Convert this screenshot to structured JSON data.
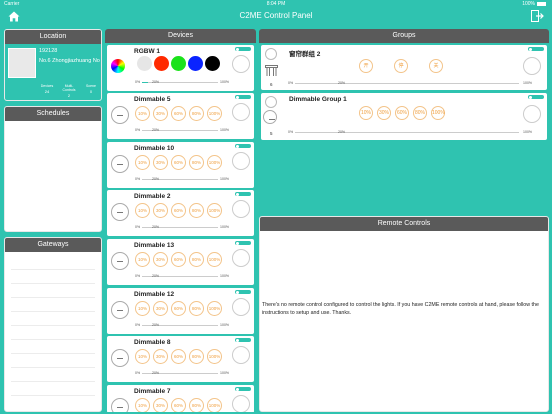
{
  "status": {
    "carrier": "Carrier",
    "time": "8:04 PM",
    "battery": "100%"
  },
  "nav": {
    "title": "C2ME Control Panel"
  },
  "location": {
    "header": "Location",
    "code": "192128",
    "address": "No.6 Zhongjiazhuang No",
    "stats": [
      {
        "label": "Devices",
        "value": "24"
      },
      {
        "label": "Multi-Controls",
        "value": "2"
      },
      {
        "label": "Scene",
        "value": "0"
      }
    ]
  },
  "schedules": {
    "header": "Schedules"
  },
  "gateways": {
    "header": "Gateways"
  },
  "devices": {
    "header": "Devices",
    "rgbw": {
      "name": "RGBW 1",
      "colors": [
        "#e6e6e6",
        "#ff2a00",
        "#1be21b",
        "#0a23ff",
        "#000000"
      ],
      "slider": {
        "lo": "0%",
        "mid": "20%",
        "hi": "100%",
        "value": 0.08
      }
    },
    "dimmables": [
      {
        "name": "Dimmable 5",
        "levels": [
          "10%",
          "30%",
          "60%",
          "80%",
          "100%"
        ],
        "slider": {
          "lo": "0%",
          "mid": "20%",
          "hi": "100%",
          "value": 0.0
        }
      },
      {
        "name": "Dimmable 10",
        "levels": [
          "10%",
          "30%",
          "60%",
          "80%",
          "100%"
        ],
        "slider": {
          "lo": "0%",
          "mid": "20%",
          "hi": "100%",
          "value": 0.0
        }
      },
      {
        "name": "Dimmable 2",
        "levels": [
          "10%",
          "30%",
          "60%",
          "80%",
          "100%"
        ],
        "slider": {
          "lo": "0%",
          "mid": "20%",
          "hi": "100%",
          "value": 0.0
        }
      },
      {
        "name": "Dimmable 13",
        "levels": [
          "10%",
          "30%",
          "60%",
          "80%",
          "100%"
        ],
        "slider": {
          "lo": "0%",
          "mid": "20%",
          "hi": "100%",
          "value": 0.0
        }
      },
      {
        "name": "Dimmable 12",
        "levels": [
          "10%",
          "30%",
          "60%",
          "80%",
          "100%"
        ],
        "slider": {
          "lo": "0%",
          "mid": "20%",
          "hi": "100%",
          "value": 0.0
        }
      },
      {
        "name": "Dimmable 8",
        "levels": [
          "10%",
          "30%",
          "60%",
          "80%",
          "100%"
        ],
        "slider": {
          "lo": "0%",
          "mid": "20%",
          "hi": "100%",
          "value": 0.0
        }
      },
      {
        "name": "Dimmable 7",
        "levels": [
          "10%",
          "30%",
          "60%",
          "80%",
          "100%"
        ],
        "slider": {
          "lo": "0%",
          "mid": "20%",
          "hi": "100%",
          "value": 0.0
        }
      }
    ]
  },
  "groups": {
    "header": "Groups",
    "items": [
      {
        "name": "窗帘群组 2",
        "count": "6",
        "buttons": [
          "开",
          "停",
          "关"
        ],
        "slider": {
          "lo": "0%",
          "mid": "20%",
          "hi": "100%",
          "value": 0.0
        }
      },
      {
        "name": "Dimmable Group 1",
        "count": "5",
        "buttons": [
          "10%",
          "30%",
          "60%",
          "80%",
          "100%"
        ],
        "slider": {
          "lo": "0%",
          "mid": "20%",
          "hi": "100%",
          "value": 0.0
        }
      }
    ]
  },
  "remote": {
    "header": "Remote Controls",
    "message": "There's no remote control configured to control the lights. If you have C2ME remote controls at hand, please follow the instructions to setup and use. Thanks."
  },
  "colors": {
    "accent": "#2fc3b0",
    "header": "#5a5a5a",
    "level": "#f0a040"
  }
}
